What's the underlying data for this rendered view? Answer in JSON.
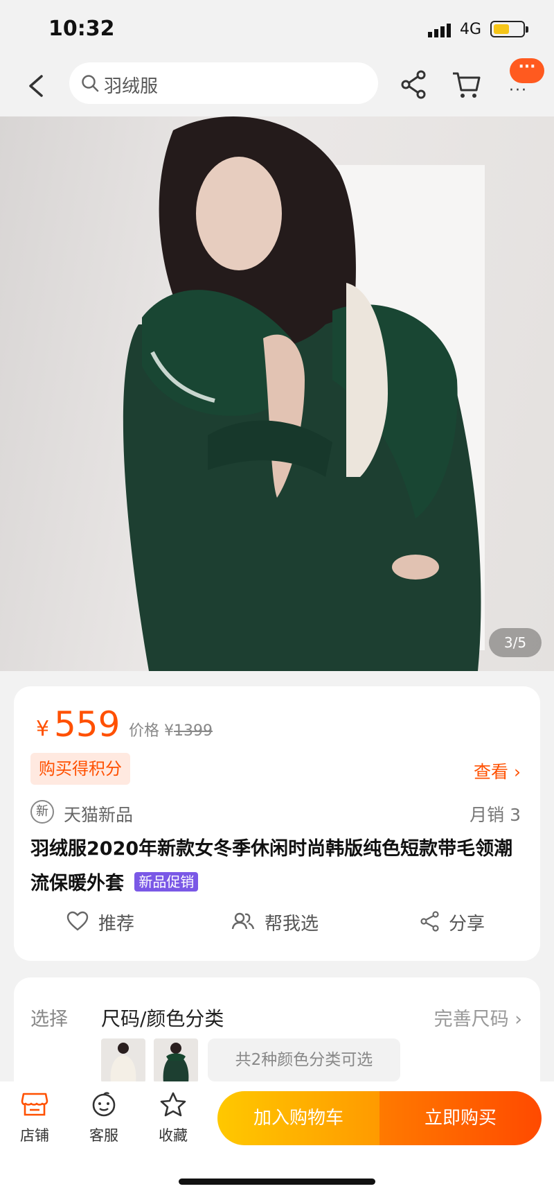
{
  "status_bar": {
    "time": "10:32",
    "network": "4G"
  },
  "nav": {
    "search_query": "羽绒服",
    "more_dots": "···"
  },
  "gallery": {
    "counter": "3/5"
  },
  "product": {
    "currency": "¥",
    "price": "559",
    "original_label": "价格 ¥",
    "original_price": "1399",
    "points_label": "购买得积分",
    "view_link": "查看 ›",
    "brand_badge": "新",
    "brand": "天猫新品",
    "monthly_sales": "月销 3",
    "title": "羽绒服2020年新款女冬季休闲时尚韩版纯色短款带毛领潮流保暖外套",
    "promo_tag": "新品促销"
  },
  "actions": {
    "recommend": "推荐",
    "help_choose": "帮我选",
    "share": "分享"
  },
  "selection": {
    "label": "选择",
    "value": "尺码/颜色分类",
    "size_link": "完善尺码",
    "colors_summary": "共2种颜色分类可选"
  },
  "bottom_bar": {
    "store": "店铺",
    "service": "客服",
    "favorite": "收藏",
    "add_to_cart": "加入购物车",
    "buy_now": "立即购买"
  },
  "colors": {
    "accent": "#ff5000",
    "promo_tag": "#7a58e6",
    "cart_button": "#ffb400",
    "buy_button": "#ff5a00",
    "jacket": "#1d3f31"
  }
}
